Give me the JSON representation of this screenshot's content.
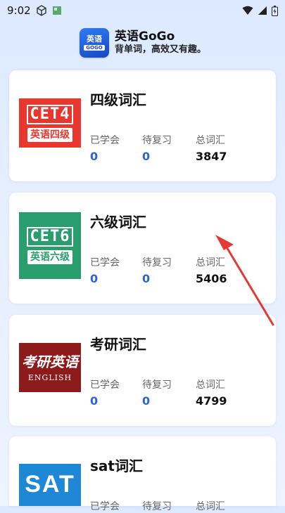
{
  "status_bar": {
    "time": "9:02"
  },
  "app": {
    "title": "英语GoGo",
    "subtitle": "背单词，高效又有趣。",
    "logo_top": "英语",
    "logo_bottom": "GOGO"
  },
  "cards": [
    {
      "title": "四级词汇",
      "cover_code": "CET4",
      "cover_badge": "英语四级",
      "learned_label": "已学会",
      "learned": "0",
      "review_label": "待复习",
      "review": "0",
      "total_label": "总词汇",
      "total": "3847"
    },
    {
      "title": "六级词汇",
      "cover_code": "CET6",
      "cover_badge": "英语六级",
      "learned_label": "已学会",
      "learned": "0",
      "review_label": "待复习",
      "review": "0",
      "total_label": "总词汇",
      "total": "5406"
    },
    {
      "title": "考研词汇",
      "cover_main": "考研英语",
      "cover_sub": "ENGLISH",
      "learned_label": "已学会",
      "learned": "0",
      "review_label": "待复习",
      "review": "0",
      "total_label": "总词汇",
      "total": "4799"
    },
    {
      "title": "sat词汇",
      "cover_main": "SAT",
      "learned_label": "已学会",
      "review_label": "待复习",
      "total_label": "总词汇"
    }
  ],
  "colors": {
    "accent": "#2d64d8",
    "annotation_arrow": "#e53935"
  }
}
